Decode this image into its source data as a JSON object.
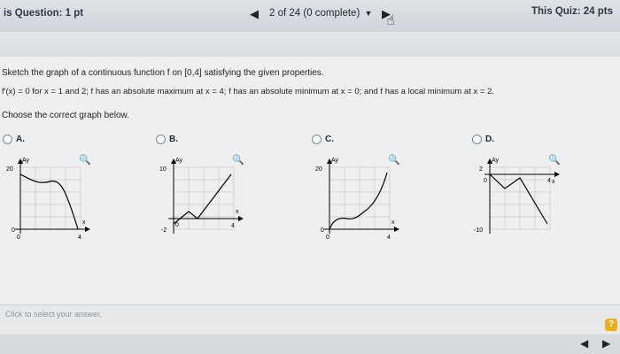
{
  "header": {
    "question_points": "is Question: 1 pt",
    "nav_prev_icon": "◀",
    "nav_status": "2 of 24 (0 complete)",
    "nav_dropdown_icon": "▼",
    "nav_next_icon": "▶",
    "quiz_points": "This Quiz: 24 pts"
  },
  "question": {
    "prompt": "Sketch the graph of a continuous function f on [0,4] satisfying the given properties.",
    "properties": "f'(x) = 0 for x = 1 and 2; f has an absolute maximum at x = 4; f has an absolute minimum at x = 0; and f has a local minimum at x = 2.",
    "instruction": "Choose the correct graph below."
  },
  "choices": [
    {
      "letter": "A.",
      "ytick_top": "20",
      "ytick_bottom": "0",
      "xtick_left": "0",
      "xtick_right": "4",
      "ylabel": "Ay",
      "xlabel": "x"
    },
    {
      "letter": "B.",
      "ytick_top": "10",
      "ytick_bottom": "-2",
      "xtick_left": "0",
      "xtick_right": "4",
      "ylabel": "Ay",
      "xlabel": "x"
    },
    {
      "letter": "C.",
      "ytick_top": "20",
      "ytick_bottom": "0",
      "xtick_left": "0",
      "xtick_right": "4",
      "ylabel": "Ay",
      "xlabel": "x"
    },
    {
      "letter": "D.",
      "ytick_top": "2",
      "ytick_bottom": "-10",
      "xtick_left": "0",
      "xtick_right": "4",
      "ylabel": "Ay",
      "xlabel": "x"
    }
  ],
  "answer": {
    "placeholder": "Click to select your answer."
  },
  "help": {
    "label": "?"
  },
  "bottom_nav": {
    "prev": "◀",
    "next": "▶"
  },
  "icons": {
    "magnify": "magnify-icon",
    "cursor": "hand-cursor-icon"
  },
  "colors": {
    "accent": "#2d3a46",
    "help_button": "#e8b020"
  }
}
